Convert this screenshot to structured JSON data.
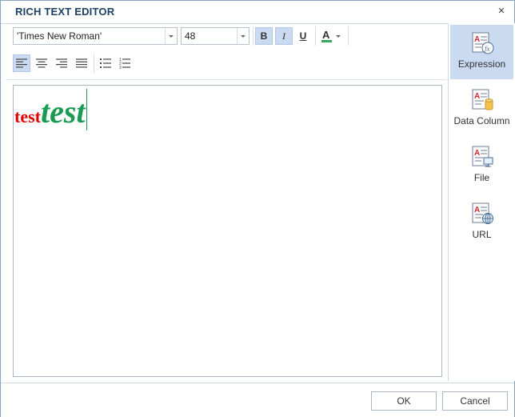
{
  "dialog": {
    "title": "RICH TEXT EDITOR",
    "close_symbol": "×"
  },
  "toolbar": {
    "font_family": "'Times New Roman'",
    "font_size": "48",
    "bold_label": "B",
    "italic_label": "I",
    "underline_label": "U",
    "font_color_label": "A",
    "font_color": "#3aa65c",
    "states": {
      "bold": true,
      "italic": true,
      "underline": false,
      "align_left": true
    }
  },
  "editor": {
    "runs": [
      {
        "text": "test",
        "color": "#e00000",
        "style": "bold"
      },
      {
        "text": "test",
        "color": "#1a9a52",
        "style": "bold-italic"
      }
    ]
  },
  "sidebar": {
    "items": [
      {
        "label": "Expression",
        "icon": "expression-icon",
        "active": true
      },
      {
        "label": "Data Column",
        "icon": "data-column-icon",
        "active": false
      },
      {
        "label": "File",
        "icon": "file-icon",
        "active": false
      },
      {
        "label": "URL",
        "icon": "url-icon",
        "active": false
      }
    ]
  },
  "footer": {
    "ok_label": "OK",
    "cancel_label": "Cancel"
  }
}
